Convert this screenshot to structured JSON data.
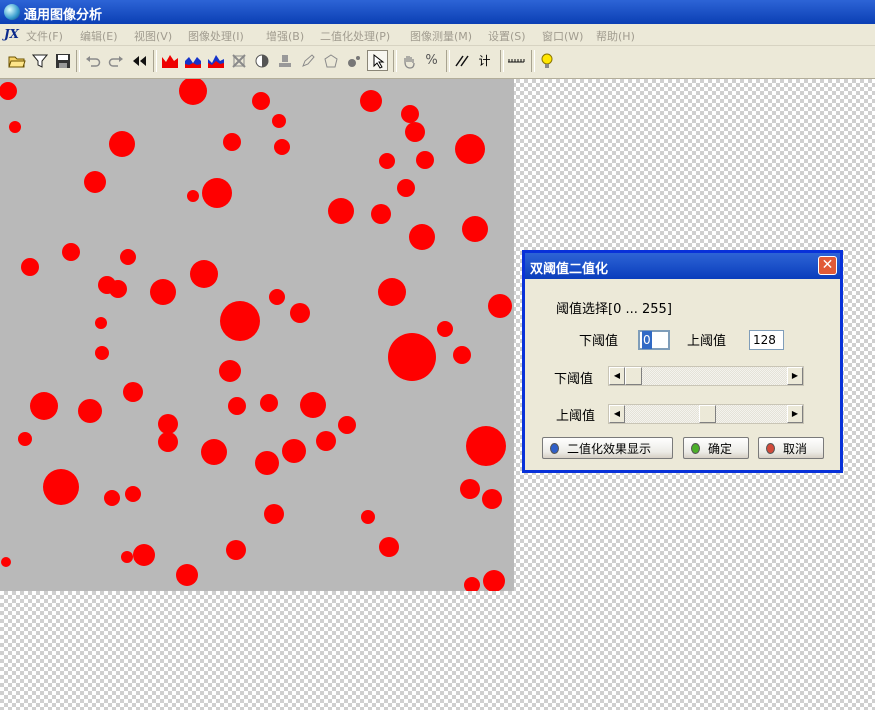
{
  "window": {
    "title": "通用图像分析"
  },
  "menubar": {
    "logo": "JX",
    "items": [
      "文件(F)",
      "编辑(E)",
      "视图(V)",
      "图像处理(I)",
      "增强(B)",
      "二值化处理(P)",
      "图像测量(M)",
      "设置(S)",
      "窗口(W)",
      "帮助(H)"
    ]
  },
  "toolbar": {
    "icons": [
      "open-folder-icon",
      "filter-icon",
      "save-icon",
      "undo-icon",
      "redo-icon",
      "rewind-icon",
      "histogram-red-icon",
      "histogram-blue-icon",
      "histogram-mixed-icon",
      "crop-icon",
      "contrast-icon",
      "stamp-icon",
      "pen-icon",
      "polygon-icon",
      "fill-icon",
      "pointer-icon",
      "hand-icon",
      "percent-icon",
      "line-icon",
      "count-icon",
      "ruler-icon",
      "lightbulb-icon"
    ],
    "count_label": "计",
    "percent_label": "%"
  },
  "dialog": {
    "title": "双阈值二值化",
    "close_label": "✕",
    "range_label": "阈值选择[0 ... 255]",
    "lower_label": "下阈值",
    "lower_value": "0",
    "upper_label": "上阈值",
    "upper_value": "128",
    "lower_slider_label": "下阈值",
    "upper_slider_label": "上阈值",
    "lower_slider_fraction": 0.0,
    "upper_slider_fraction": 0.5,
    "buttons": {
      "preview": "二值化效果显示",
      "ok": "确定",
      "cancel": "取消"
    },
    "colors": {
      "preview_led": "#2f5fc8",
      "ok_led": "#4caf2a",
      "cancel_led": "#d24a3a"
    }
  },
  "image": {
    "particle_color": "#ff0000",
    "background_color": "#b9b9b9"
  }
}
